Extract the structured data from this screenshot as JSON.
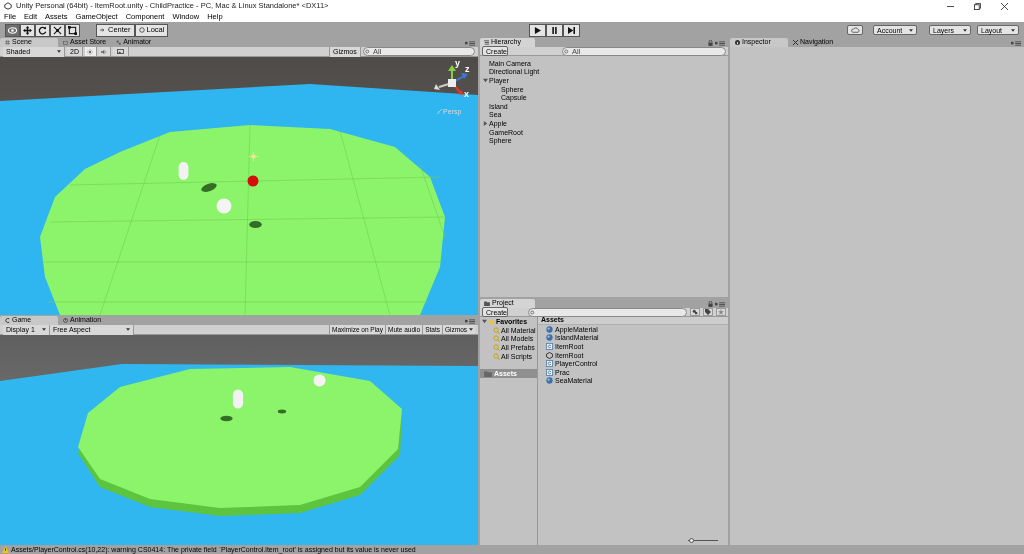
{
  "window": {
    "title": "Unity Personal (64bit) - ItemRoot.unity - ChildPractice - PC, Mac & Linux Standalone* <DX11>"
  },
  "menu": [
    "File",
    "Edit",
    "Assets",
    "GameObject",
    "Component",
    "Window",
    "Help"
  ],
  "toolbar": {
    "tools": [
      {
        "kind": "hand",
        "selected": true
      },
      {
        "kind": "move",
        "selected": false
      },
      {
        "kind": "rotate",
        "selected": false
      },
      {
        "kind": "scale",
        "selected": false
      },
      {
        "kind": "rect",
        "selected": false
      }
    ],
    "pivot": "Center",
    "space": "Local",
    "playback": [
      {
        "kind": "play"
      },
      {
        "kind": "pause"
      },
      {
        "kind": "step"
      }
    ],
    "account": "Account",
    "layers": "Layers",
    "layout": "Layout"
  },
  "scene_panel": {
    "tabs": [
      {
        "label": "Scene",
        "selected": true
      },
      {
        "label": "Asset Store",
        "selected": false
      },
      {
        "label": "Animator",
        "selected": false
      }
    ],
    "shading": "Shaded",
    "mode_2d": "2D",
    "gizmos": "Gizmos",
    "search": {
      "placeholder": "All"
    },
    "gizmo_axes": [
      "y",
      "x",
      "z"
    ],
    "projection": "Persp"
  },
  "game_panel": {
    "tabs": [
      {
        "label": "Game",
        "selected": true
      },
      {
        "label": "Animation",
        "selected": false
      }
    ],
    "display": "Display 1",
    "aspect": "Free Aspect",
    "buttons": [
      "Maximize on Play",
      "Mute audio",
      "Stats",
      "Gizmos"
    ]
  },
  "hierarchy": {
    "tab": "Hierarchy",
    "create": "Create",
    "search": {
      "placeholder": "All"
    },
    "items": [
      {
        "label": "Main Camera"
      },
      {
        "label": "Directional Light"
      },
      {
        "label": "Player",
        "kind": "group",
        "expanded": true,
        "children": [
          {
            "label": "Sphere"
          },
          {
            "label": "Capsule"
          }
        ]
      },
      {
        "label": "Island"
      },
      {
        "label": "Sea"
      },
      {
        "label": "Apple",
        "kind": "group",
        "expanded": false
      },
      {
        "label": "GameRoot"
      },
      {
        "label": "Sphere"
      }
    ]
  },
  "project": {
    "tab": "Project",
    "create": "Create",
    "favorites": {
      "label": "Favorites",
      "expanded": true,
      "items": [
        "All Material",
        "All Models",
        "All Prefabs",
        "All Scripts"
      ]
    },
    "folders": [
      {
        "label": "Assets",
        "selected": true
      }
    ],
    "breadcrumb": "Assets",
    "assets": [
      {
        "name": "AppleMaterial",
        "kind": "material"
      },
      {
        "name": "IslandMaterial",
        "kind": "material"
      },
      {
        "name": "ItemRoot",
        "kind": "script"
      },
      {
        "name": "ItemRoot",
        "kind": "scene"
      },
      {
        "name": "PlayerControl",
        "kind": "script"
      },
      {
        "name": "Prac",
        "kind": "script"
      },
      {
        "name": "SeaMaterial",
        "kind": "material"
      }
    ],
    "icon_size": {
      "level": 0.05
    }
  },
  "inspector": {
    "tabs": [
      {
        "label": "Inspector",
        "selected": true
      },
      {
        "label": "Navigation",
        "selected": false
      }
    ]
  },
  "status_bar": "Assets/PlayerControl.cs(10,22): warning CS0414: The private field `PlayerControl.item_root' is assigned but its value is never used"
}
